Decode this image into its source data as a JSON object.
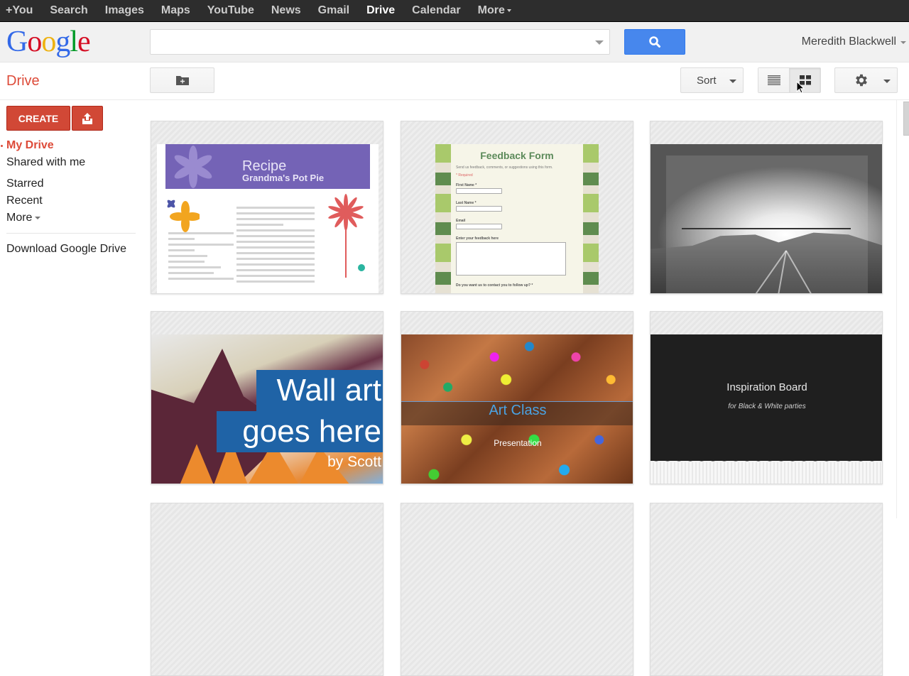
{
  "topbar": {
    "items": [
      {
        "label": "+You",
        "active": false
      },
      {
        "label": "Search",
        "active": false
      },
      {
        "label": "Images",
        "active": false
      },
      {
        "label": "Maps",
        "active": false
      },
      {
        "label": "YouTube",
        "active": false
      },
      {
        "label": "News",
        "active": false
      },
      {
        "label": "Gmail",
        "active": false
      },
      {
        "label": "Drive",
        "active": true
      },
      {
        "label": "Calendar",
        "active": false
      },
      {
        "label": "More",
        "active": false,
        "has_dropdown": true
      }
    ]
  },
  "header": {
    "logo_letters": [
      "G",
      "o",
      "o",
      "g",
      "l",
      "e"
    ],
    "search": {
      "value": "",
      "placeholder": ""
    },
    "search_icon": "magnifier-icon",
    "user_name": "Meredith Blackwell"
  },
  "toolbar": {
    "app_title": "Drive",
    "new_folder_icon": "folder-plus-icon",
    "sort_label": "Sort",
    "list_view_icon": "list-icon",
    "grid_view_icon": "grid-icon",
    "active_view": "grid",
    "settings_icon": "gear-icon"
  },
  "sidebar": {
    "create_label": "CREATE",
    "upload_icon": "upload-icon",
    "items": [
      {
        "label": "My Drive",
        "active": true
      },
      {
        "label": "Shared with me",
        "active": false
      },
      {
        "label": "Starred",
        "active": false
      },
      {
        "label": "Recent",
        "active": false
      },
      {
        "label": "More",
        "active": false,
        "has_dropdown": true
      }
    ],
    "download_label": "Download Google Drive"
  },
  "files": [
    {
      "type": "document",
      "title": "Recipe",
      "subtitle": "Grandma's Pot Pie",
      "accent": "#7463b6"
    },
    {
      "type": "form",
      "title": "Feedback Form",
      "description": "Send us feedback, comments, or suggestions using this form.",
      "required_note": "* Required",
      "fields": [
        "First Name *",
        "Last Name *",
        "Email",
        "Enter your feedback here"
      ],
      "question": "Do you want us to contact you to follow up? *",
      "accent": "#5c8a5a"
    },
    {
      "type": "image",
      "title": "",
      "description": "sunrise over mountains (grayscale)"
    },
    {
      "type": "presentation",
      "title_line1": "Wall art",
      "title_line2": "goes here",
      "subtitle": "by Scott",
      "accent": "#1f63a6"
    },
    {
      "type": "presentation",
      "title": "Art Class",
      "subtitle": "Presentation",
      "accent": "#4aa3e3"
    },
    {
      "type": "presentation",
      "title": "Inspiration Board",
      "subtitle": "for Black & White parties",
      "accent": "#1f1f1f"
    }
  ]
}
